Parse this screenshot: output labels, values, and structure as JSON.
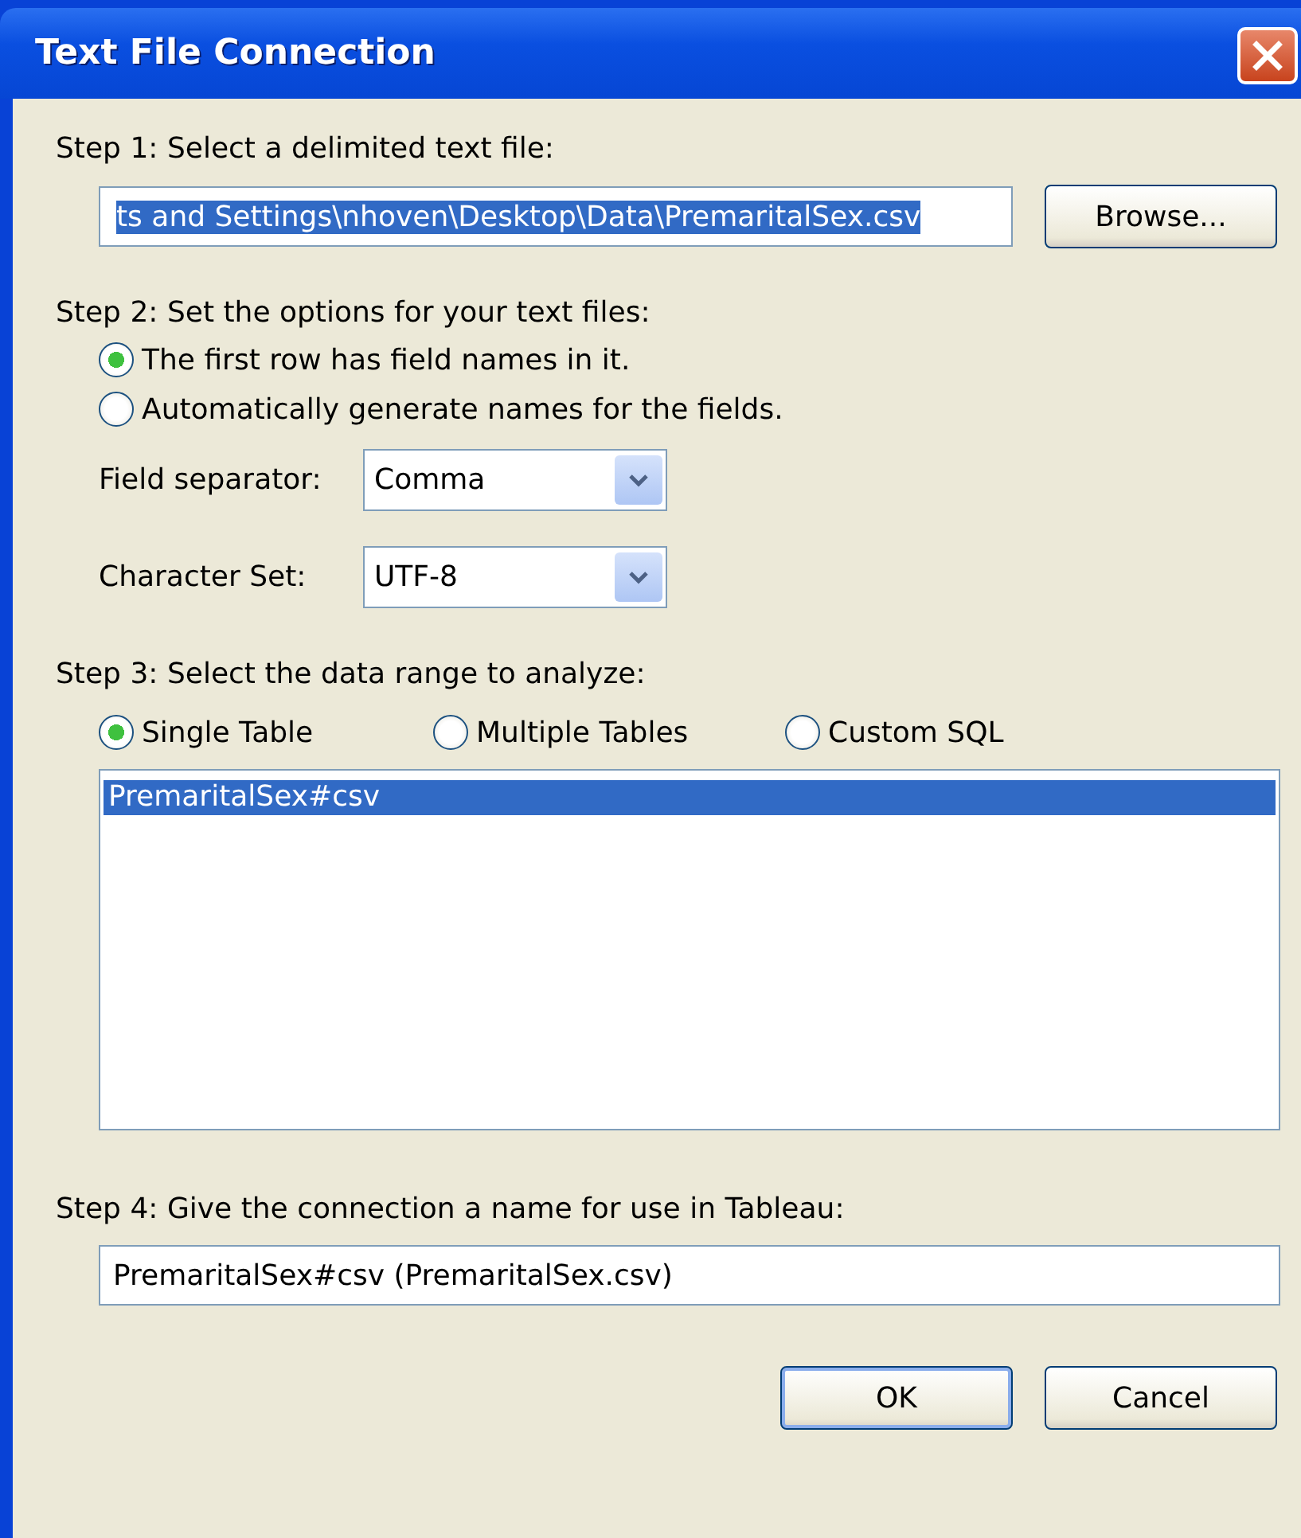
{
  "window": {
    "title": "Text File Connection"
  },
  "step1": {
    "label": "Step 1: Select a delimited text file:",
    "file_path": "ts and Settings\\nhoven\\Desktop\\Data\\PremaritalSex.csv",
    "text_selected": true,
    "browse_button": "Browse..."
  },
  "step2": {
    "label": "Step 2: Set the options for your text files:",
    "options": [
      {
        "label": "The first row has field names in it.",
        "selected": true
      },
      {
        "label": "Automatically generate names for the fields.",
        "selected": false
      }
    ],
    "dropdowns": [
      {
        "label": "Field separator:",
        "value": "Comma"
      },
      {
        "label": "Character Set:",
        "value": "UTF-8"
      }
    ]
  },
  "step3": {
    "label": "Step 3: Select the data range to analyze:",
    "options": [
      {
        "label": "Single Table",
        "selected": true
      },
      {
        "label": "Multiple Tables",
        "selected": false
      },
      {
        "label": "Custom SQL",
        "selected": false
      }
    ],
    "tables": [
      {
        "label": "PremaritalSex#csv",
        "selected": true
      }
    ]
  },
  "step4": {
    "label": "Step 4: Give the connection a name for use in Tableau:",
    "connection_name": "PremaritalSex#csv (PremaritalSex.csv)"
  },
  "buttons": [
    {
      "label": "OK",
      "default": true
    },
    {
      "label": "Cancel",
      "default": false
    }
  ]
}
